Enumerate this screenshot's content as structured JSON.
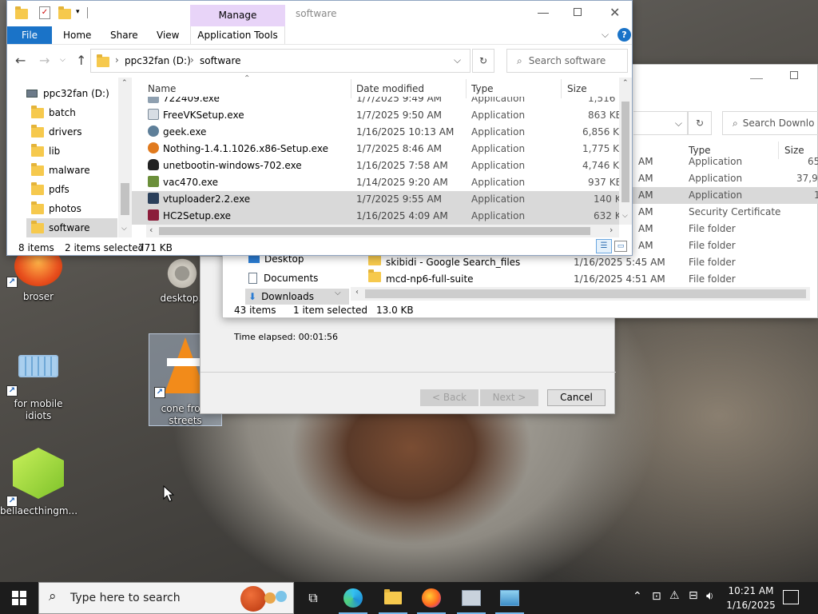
{
  "desktop": {
    "icons": [
      {
        "label": "broser"
      },
      {
        "label": "desktop.i"
      },
      {
        "label": "for mobile idiots"
      },
      {
        "label": "cone from streets"
      },
      {
        "label": "bellaecthingm..."
      }
    ]
  },
  "explorer_front": {
    "title": "software",
    "manage_tab": "Manage",
    "ribbon_tabs": [
      "File",
      "Home",
      "Share",
      "View",
      "Application Tools"
    ],
    "address": {
      "drive": "ppc32fan (D:)",
      "folder": "software"
    },
    "search_placeholder": "Search software",
    "columns": {
      "name": "Name",
      "date": "Date modified",
      "type": "Type",
      "size": "Size"
    },
    "nav": {
      "drive": "ppc32fan (D:)",
      "folders": [
        "batch",
        "drivers",
        "lib",
        "malware",
        "pdfs",
        "photos",
        "software"
      ]
    },
    "files": [
      {
        "name": "722409.exe",
        "date": "1/7/2025 9:49 AM",
        "type": "Application",
        "size": "1,516 KB"
      },
      {
        "name": "FreeVKSetup.exe",
        "date": "1/7/2025 9:50 AM",
        "type": "Application",
        "size": "863 KB"
      },
      {
        "name": "geek.exe",
        "date": "1/16/2025 10:13 AM",
        "type": "Application",
        "size": "6,856 KB"
      },
      {
        "name": "Nothing-1.4.1.1026.x86-Setup.exe",
        "date": "1/7/2025 8:46 AM",
        "type": "Application",
        "size": "1,775 KB"
      },
      {
        "name": "unetbootin-windows-702.exe",
        "date": "1/16/2025 7:58 AM",
        "type": "Application",
        "size": "4,746 KB"
      },
      {
        "name": "vac470.exe",
        "date": "1/14/2025 9:20 AM",
        "type": "Application",
        "size": "937 KB"
      },
      {
        "name": "vtuploader2.2.exe",
        "date": "1/7/2025 9:55 AM",
        "type": "Application",
        "size": "140 KB"
      },
      {
        "name": "HC2Setup.exe",
        "date": "1/16/2025 4:09 AM",
        "type": "Application",
        "size": "632 KB"
      }
    ],
    "status": {
      "items": "8 items",
      "selected": "2 items selected",
      "size": "771 KB"
    }
  },
  "explorer_back": {
    "search_placeholder": "Search Downlo",
    "columns": {
      "type": "Type",
      "size": "Size"
    },
    "rows": [
      {
        "date": "AM",
        "type": "Application",
        "size": "65"
      },
      {
        "date": "AM",
        "type": "Application",
        "size": "37,96"
      },
      {
        "date": "AM",
        "type": "Application",
        "size": "1"
      },
      {
        "date": "AM",
        "type": "Security Certificate",
        "size": ""
      },
      {
        "date": "AM",
        "type": "File folder",
        "size": ""
      },
      {
        "date": "AM",
        "type": "File folder",
        "size": ""
      },
      {
        "name": "skibidi - Google Search_files",
        "date": "1/16/2025 5:45 AM",
        "type": "File folder",
        "size": ""
      },
      {
        "name": "mcd-np6-full-suite",
        "date": "1/16/2025 4:51 AM",
        "type": "File folder",
        "size": ""
      }
    ],
    "nav": [
      "Desktop",
      "Documents",
      "Downloads"
    ],
    "status": {
      "items": "43 items",
      "selected": "1 item selected",
      "size": "13.0 KB"
    }
  },
  "wizard": {
    "elapsed": "Time elapsed: 00:01:56",
    "back": "< Back",
    "next": "Next >",
    "cancel": "Cancel"
  },
  "taskbar": {
    "search_placeholder": "Type here to search",
    "time": "10:21 AM",
    "date": "1/16/2025"
  },
  "colors": {
    "accent": "#1a73c8",
    "manage_tab": "#e8d4f8",
    "selection": "#cce8ff"
  }
}
